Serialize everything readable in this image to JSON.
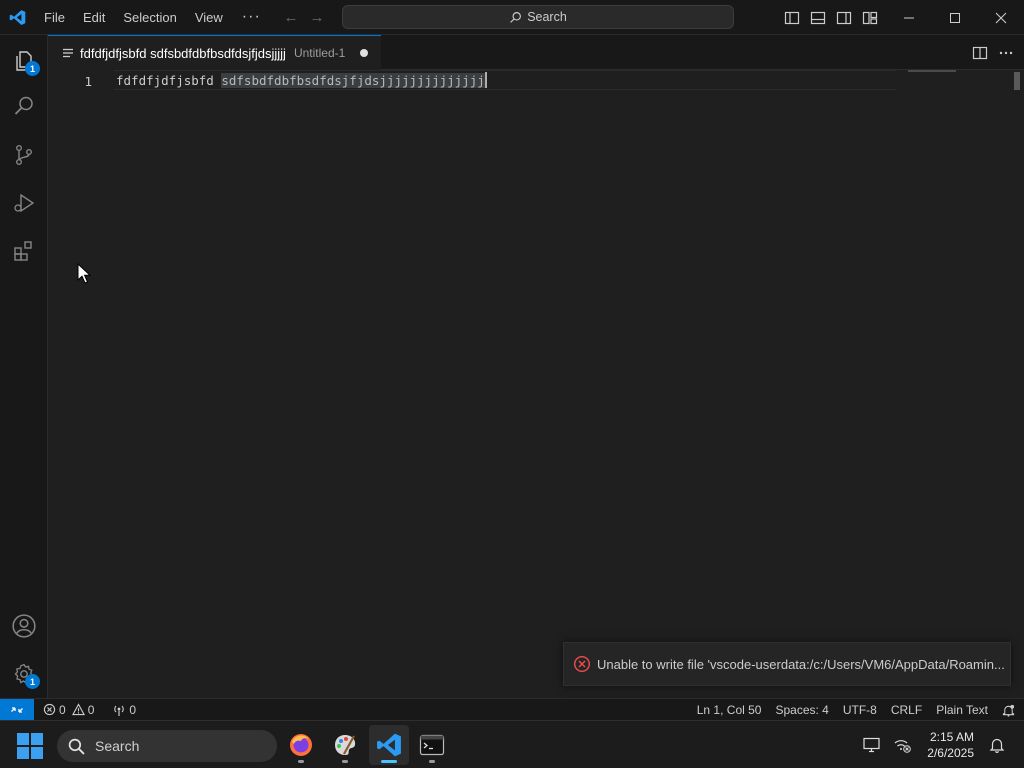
{
  "titlebar": {
    "menus": [
      "File",
      "Edit",
      "Selection",
      "View"
    ],
    "more": "···",
    "search_label": "Search"
  },
  "activity_bar": {
    "explorer_badge": "1",
    "manage_badge": "1"
  },
  "tab": {
    "title": "fdfdfjdfjsbfd sdfsbdfdbfbsdfdsjfjdsjjjjj",
    "description": "Untitled-1"
  },
  "editor": {
    "line_number": "1",
    "text_plain": "fdfdfjdfjsbfd ",
    "text_selected": "sdfsbdfdbfbsdfdsjfjdsjjjjjjjjjjjjjj"
  },
  "notification": {
    "message": "Unable to write file 'vscode-userdata:/c:/Users/VM6/AppData/Roamin..."
  },
  "statusbar": {
    "errors": "0",
    "warnings": "0",
    "ports": "0",
    "position": "Ln 1, Col 50",
    "spaces": "Spaces: 4",
    "encoding": "UTF-8",
    "eol": "CRLF",
    "language": "Plain Text"
  },
  "taskbar": {
    "search_label": "Search",
    "time": "2:15 AM",
    "date": "2/6/2025"
  },
  "colors": {
    "accent": "#0078d4",
    "error": "#f14c4c"
  }
}
